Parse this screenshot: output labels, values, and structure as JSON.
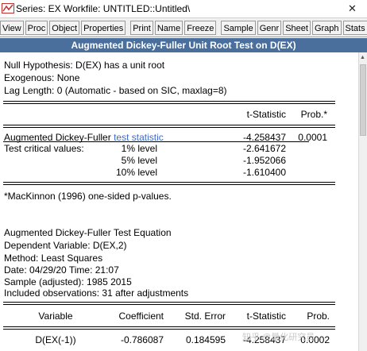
{
  "window": {
    "title": "Series: EX   Workfile: UNTITLED::Untitled\\",
    "close_glyph": "✕"
  },
  "toolbar": {
    "buttons": [
      "View",
      "Proc",
      "Object",
      "Properties",
      "Print",
      "Name",
      "Freeze",
      "Sample",
      "Genr",
      "Sheet",
      "Graph",
      "Stats"
    ]
  },
  "header": {
    "title": "Augmented Dickey-Fuller Unit Root Test on D(EX)"
  },
  "test": {
    "null_hypothesis": "Null Hypothesis: D(EX) has a unit root",
    "exogenous": "Exogenous: None",
    "lag_length": "Lag Length: 0 (Automatic - based on SIC, maxlag=8)",
    "col_tstat": "t-Statistic",
    "col_prob": "Prob.*",
    "adf_label_a": "Augmented Dickey-Fuller ",
    "adf_label_b": "test statistic",
    "adf_tstat": "-4.258437",
    "adf_prob": "0.0001",
    "crit_label": "Test critical values:",
    "crit": [
      {
        "level": "1% level",
        "value": "-2.641672"
      },
      {
        "level": "5% level",
        "value": "-1.952066"
      },
      {
        "level": "10% level",
        "value": "-1.610400"
      }
    ],
    "footnote": "*MacKinnon (1996) one-sided p-values."
  },
  "equation": {
    "title": "Augmented Dickey-Fuller Test Equation",
    "dependent": "Dependent Variable: D(EX,2)",
    "method": "Method: Least Squares",
    "date": "Date: 04/29/20   Time: 21:07",
    "sample": "Sample (adjusted): 1985 2015",
    "observations": "Included observations: 31 after adjustments",
    "headers": {
      "variable": "Variable",
      "coefficient": "Coefficient",
      "stderr": "Std. Error",
      "tstat": "t-Statistic",
      "prob": "Prob."
    },
    "rows": [
      {
        "variable": "D(EX(-1))",
        "coefficient": "-0.786087",
        "stderr": "0.184595",
        "tstat": "-4.258437",
        "prob": "0.0002"
      }
    ]
  },
  "watermark": "知乎 @量化研究员",
  "colors": {
    "header_bg": "#4a6f9c",
    "highlight": "#3a6ad0",
    "toolbar_bg": "#f0f0f0"
  },
  "icons": {
    "app": "eviews-app-icon",
    "scroll_up": "scroll-up-arrow-icon"
  }
}
